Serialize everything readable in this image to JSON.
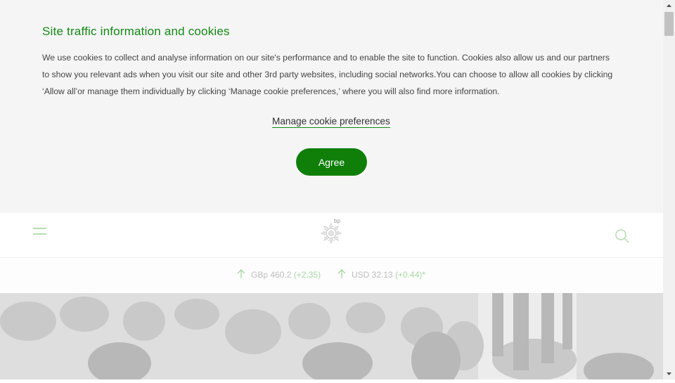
{
  "cookie_banner": {
    "title": "Site traffic information and cookies",
    "text": "We use cookies to collect and analyse information on our site's performance and to enable the site to function. Cookies also allow us and our partners to show you relevant ads when you visit our site and other 3rd party websites, including social networks.You can choose to allow all cookies by clicking ‘Allow all’or manage them individually by clicking ‘Manage cookie preferences,’ where you will also find more information.",
    "manage_label": "Manage cookie preferences",
    "agree_label": "Agree"
  },
  "header": {
    "logo_text": "bp"
  },
  "ticker": {
    "items": [
      {
        "label": "GBp 460.2",
        "change": "(+2.35)",
        "direction": "up"
      },
      {
        "label": "USD 32.13",
        "change": "(+0.44)*",
        "direction": "up"
      }
    ]
  },
  "colors": {
    "brand_green": "#118a13",
    "button_green": "#0f7f0a",
    "ticker_green": "#a8d6a2"
  }
}
